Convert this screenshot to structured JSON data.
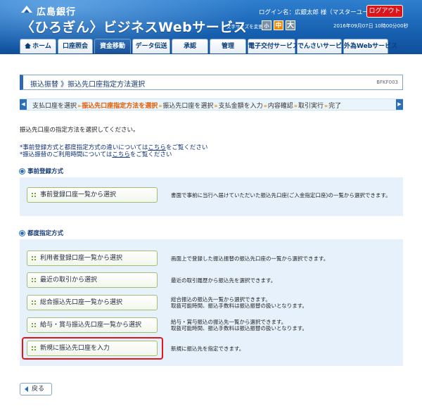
{
  "header": {
    "bank_name": "広島銀行",
    "service_name": "〈ひろぎん〉ビジネスWebサービス",
    "login_name": "ログイン名：広銀太郎 様（マスターユーザ）",
    "logout_label": "ログアウト",
    "font_size_label": "文字サイズを変更",
    "font_small": "小",
    "font_medium": "中",
    "font_large": "大",
    "datetime": "2016年09月07日 10時00分00秒"
  },
  "nav": {
    "home": "ホーム",
    "account_inquiry": "口座照会",
    "transfer": "資金移動",
    "data_transmission": "データ伝送",
    "approval": "承認",
    "management": "管理",
    "e_delivery": "電子交付サービス",
    "densai": "でんさいサービス",
    "fx_web": "外為Webサービス"
  },
  "page": {
    "title": "振込振替 》振込先口座指定方法選択",
    "screen_id": "BFKF003"
  },
  "steps": {
    "items": [
      "支払口座を選択",
      "振込先口座指定方法を選択",
      "振込先口座を選択",
      "支払金額を入力",
      "内容確認",
      "取引実行",
      "完了"
    ],
    "separator": "»"
  },
  "instruction": "振込先口座の指定方法を選択してください。",
  "notes": [
    {
      "prefix": "*事前登録方式と都度指定方式の違いについては",
      "link": "こちら",
      "suffix": "をご覧ください"
    },
    {
      "prefix": "*振込振替のご利用時間については",
      "link": "こちら",
      "suffix": "をご覧ください"
    }
  ],
  "sections": {
    "pre_registered": {
      "title": "事前登録方式",
      "options": [
        {
          "label": "事前登録口座一覧から選択",
          "desc": [
            "書面で事前に当行へ届けていただいた振込先口座(ご入金指定口座)の一覧から選択できます。"
          ]
        }
      ]
    },
    "each_time": {
      "title": "都度指定方式",
      "options": [
        {
          "label": "利用者登録口座一覧から選択",
          "desc": [
            "画面上で登録した振込振替の振込先口座の一覧から選択できます。"
          ]
        },
        {
          "label": "最近の取引から選択",
          "desc": [
            "最近の取引履歴から振込先を選択できます。"
          ]
        },
        {
          "label": "総合振込先口座一覧から選択",
          "desc": [
            "総合振込の振込先一覧から選択できます。",
            "取扱可能時間、振込手数料は振込振替の扱いとなります。"
          ]
        },
        {
          "label": "給与・賞与振込先口座一覧から選択",
          "desc": [
            "給与・賞与振込の振込先一覧から選択できます。",
            "取扱可能時間、振込手数料は振込振替の扱いとなります。"
          ]
        },
        {
          "label": "新規に振込先口座を入力",
          "desc": [
            "新規に振込先を指定できます。"
          ]
        }
      ]
    }
  },
  "back_label": "戻る",
  "colors": {
    "header_blue": "#1760b0",
    "nav_active": "#1a5198",
    "logout_red": "#d9161b",
    "step_current": "#e85a00",
    "panel_bg": "#e6f1fb",
    "button_border_green": "#9fbf6e",
    "highlight_red": "#e4161c"
  }
}
